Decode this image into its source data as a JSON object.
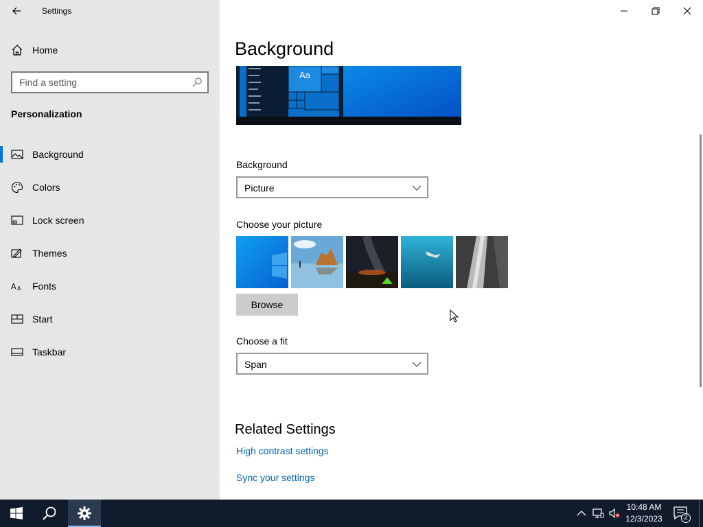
{
  "window": {
    "title": "Settings"
  },
  "nav": {
    "home_label": "Home",
    "search_placeholder": "Find a setting",
    "section_title": "Personalization",
    "items": [
      {
        "label": "Background",
        "icon": "picture-icon",
        "selected": true
      },
      {
        "label": "Colors",
        "icon": "palette-icon",
        "selected": false
      },
      {
        "label": "Lock screen",
        "icon": "lock-screen-icon",
        "selected": false
      },
      {
        "label": "Themes",
        "icon": "themes-icon",
        "selected": false
      },
      {
        "label": "Fonts",
        "icon": "fonts-icon",
        "selected": false
      },
      {
        "label": "Start",
        "icon": "start-icon",
        "selected": false
      },
      {
        "label": "Taskbar",
        "icon": "taskbar-icon",
        "selected": false
      }
    ]
  },
  "content": {
    "page_title": "Background",
    "preview_text": "Aa",
    "background_label": "Background",
    "background_value": "Picture",
    "choose_picture_label": "Choose your picture",
    "browse_label": "Browse",
    "choose_fit_label": "Choose a fit",
    "fit_value": "Span",
    "related_title": "Related Settings",
    "links": [
      "High contrast settings",
      "Sync your settings"
    ]
  },
  "taskbar": {
    "time": "10:48 AM",
    "date": "12/3/2023",
    "notification_count": "2"
  },
  "colors": {
    "accent": "#0078d7",
    "link": "#0063b1",
    "nav_bg": "#e6e6e6",
    "taskbar_bg": "#101c2c"
  }
}
